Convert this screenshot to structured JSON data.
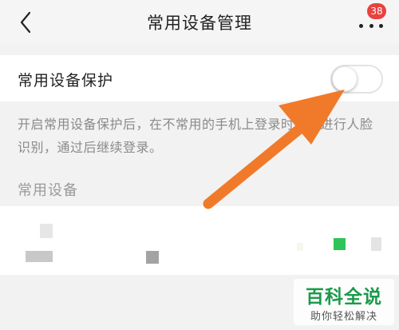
{
  "header": {
    "title": "常用设备管理",
    "badge_count": "38",
    "back_icon": "chevron-left-icon",
    "more_icon": "more-dots-icon"
  },
  "protection": {
    "label": "常用设备保护",
    "enabled": false,
    "description": "开启常用设备保护后，在不常用的手机上登录时需要进行人脸识别，通过后继续登录。"
  },
  "devices": {
    "section_title": "常用设备"
  },
  "overlay": {
    "arrow_color": "#f07a2a"
  },
  "watermark": {
    "main": "百科全说",
    "sub": "助你轻松解决"
  },
  "colors": {
    "badge": "#e8423f",
    "watermark_green": "#1b9a4b"
  }
}
